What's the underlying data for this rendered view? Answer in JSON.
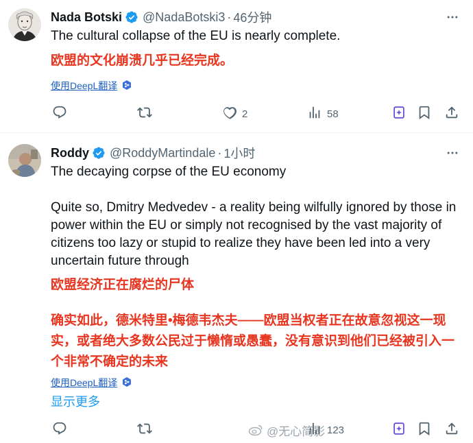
{
  "tweets": [
    {
      "author_name": "Nada Botski",
      "handle": "@NadaBotski3",
      "separator": "·",
      "time": "46分钟",
      "text_en": "The cultural collapse of the EU is nearly complete.",
      "text_zh": "欧盟的文化崩溃几乎已经完成。",
      "translate_label": "使用DeepL翻译",
      "stats": {
        "replies": "",
        "retweets": "",
        "likes": "2",
        "views": "58"
      }
    },
    {
      "author_name": "Roddy",
      "handle": "@RoddyMartindale",
      "separator": "·",
      "time": "1小时",
      "text_en_1": "The decaying corpse of the EU economy",
      "text_en_2": "Quite so, Dmitry Medvedev - a reality being wilfully ignored by those in power within the EU or simply not recognised by the vast majority of citizens too lazy or stupid to realize they have been led into a very uncertain future through",
      "text_zh_1": "欧盟经济正在腐烂的尸体",
      "text_zh_2": "确实如此，德米特里•梅德韦杰夫——欧盟当权者正在故意忽视这一现实，或者绝大多数公民过于懒惰或愚蠢，没有意识到他们已经被引入一个非常不确定的未来",
      "translate_label": "使用DeepL翻译",
      "show_more": "显示更多",
      "stats": {
        "replies": "",
        "retweets": "",
        "likes": "",
        "views": "123"
      },
      "watermark": "@无心简影"
    }
  ],
  "colors": {
    "verified": "#1d9bf0",
    "translate_badge": "#3b6fd9",
    "grok": "#6c4fd6",
    "chinese_text": "#e8351f"
  },
  "icons": [
    "verified-badge-icon",
    "more-options-icon",
    "reply-icon",
    "retweet-icon",
    "like-icon",
    "views-icon",
    "grok-icon",
    "bookmark-icon",
    "share-icon",
    "deepl-icon",
    "weibo-icon"
  ]
}
